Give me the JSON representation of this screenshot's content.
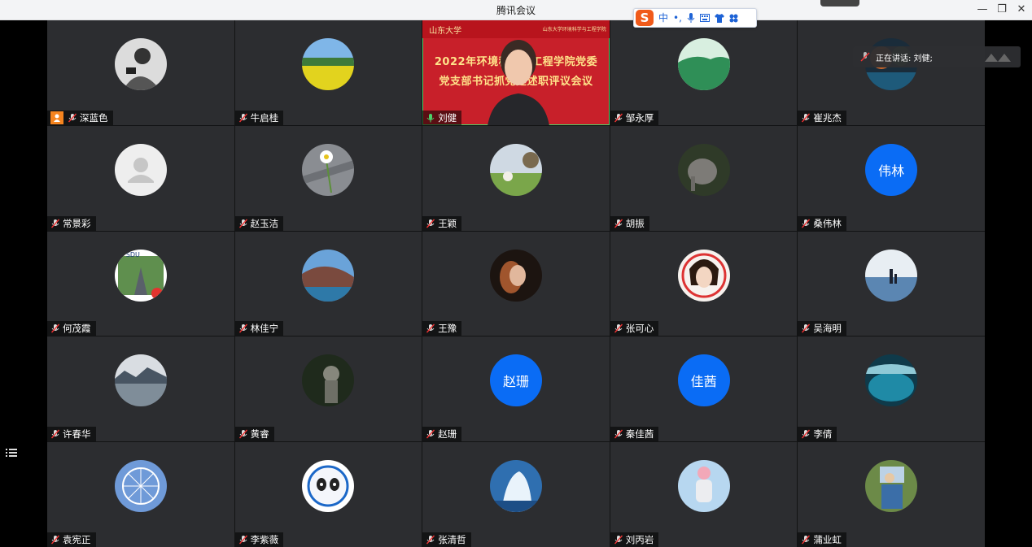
{
  "window": {
    "title": "腾讯会议",
    "controls": [
      "—",
      "❐",
      "✕"
    ]
  },
  "ime": {
    "brand": "S",
    "mode": "中",
    "items": [
      "•,",
      "mic-icon",
      "keyboard-icon",
      "shirt-icon",
      "apps-icon"
    ]
  },
  "speaking": {
    "label": "正在讲话: 刘健;"
  },
  "banner": {
    "logo_left": "山东大学",
    "logo_right": "山东大学环境科学与工程学院",
    "line1": "2022年环境科学与工程学院党委",
    "line2": "党支部书记抓党建述职评议会议"
  },
  "colors": {
    "accent_blue": "#0a6cf5",
    "host_orange": "#f5841f",
    "tile_bg": "#2c2d30",
    "speaking_green": "#4bd36a",
    "banner_red": "#c8202a"
  },
  "participants": [
    {
      "name": "深蓝色",
      "host": true,
      "avatar": "photo-bw-portrait"
    },
    {
      "name": "牛启桂",
      "avatar": "photo-rapeseed-field"
    },
    {
      "name": "刘健",
      "video": true,
      "speaking": true
    },
    {
      "name": "邹永厚",
      "avatar": "photo-green-hills"
    },
    {
      "name": "崔兆杰",
      "avatar": "photo-autumn-lake"
    },
    {
      "name": "常景彩",
      "avatar": "default-user-icon"
    },
    {
      "name": "赵玉洁",
      "avatar": "photo-daisy"
    },
    {
      "name": "王颖",
      "avatar": "photo-dog-on-grass"
    },
    {
      "name": "胡振",
      "avatar": "photo-elephant"
    },
    {
      "name": "桑伟林",
      "avatar_text": "伟林"
    },
    {
      "name": "何茂霞",
      "avatar": "photo-sdu-road",
      "avatar_label": "SDU"
    },
    {
      "name": "林佳宁",
      "avatar": "photo-coastline"
    },
    {
      "name": "王豫",
      "avatar": "photo-woman-portrait"
    },
    {
      "name": "张可心",
      "avatar": "photo-cartoon-princess"
    },
    {
      "name": "吴海明",
      "avatar": "photo-beach-family"
    },
    {
      "name": "许春华",
      "avatar": "photo-reed-lake"
    },
    {
      "name": "黄睿",
      "avatar": "photo-statue-forest"
    },
    {
      "name": "赵珊",
      "avatar_text": "赵珊"
    },
    {
      "name": "秦佳茜",
      "avatar_text": "佳茜"
    },
    {
      "name": "李倩",
      "avatar": "photo-blue-lake"
    },
    {
      "name": "袁宪正",
      "avatar": "photo-ferris-wheel"
    },
    {
      "name": "李紫薇",
      "avatar": "photo-panda-mascot"
    },
    {
      "name": "张清哲",
      "avatar": "photo-waterfall"
    },
    {
      "name": "刘丙岩",
      "avatar": "photo-astronaut-girl"
    },
    {
      "name": "蒲业虹",
      "avatar": "photo-painting"
    }
  ]
}
